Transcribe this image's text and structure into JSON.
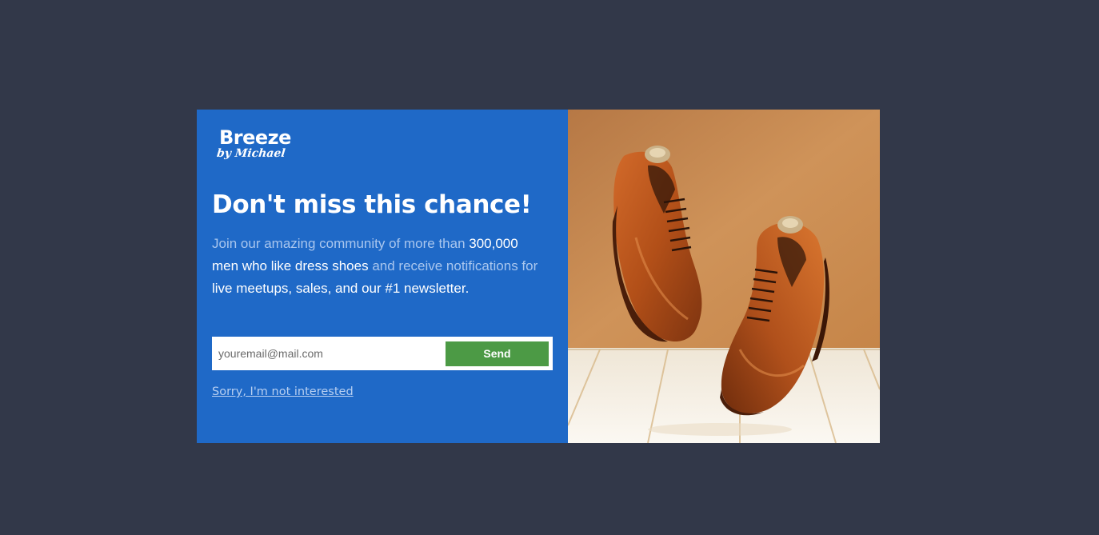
{
  "modal": {
    "logo": {
      "brand": "Breeze",
      "sub": "by Michael"
    },
    "headline": "Don't miss this chance!",
    "body": {
      "p1": "Join our amazing community of more than ",
      "p2": "300,000 men who like dress shoes",
      "p3": " and receive notifications for ",
      "p4": "live meetups, sales, and our #1 newsletter."
    },
    "form": {
      "email_placeholder": "youremail@mail.com",
      "email_value": "",
      "send_label": "Send"
    },
    "decline_label": "Sorry, I'm not interested",
    "image": {
      "subject": "brown-leather-dress-shoes-photo"
    }
  },
  "colors": {
    "page_background": "#323849",
    "panel_blue": "#1f69c7",
    "send_green": "#4c9a45",
    "muted_text": "#a9c6ee",
    "highlight_text": "#ffffff"
  }
}
